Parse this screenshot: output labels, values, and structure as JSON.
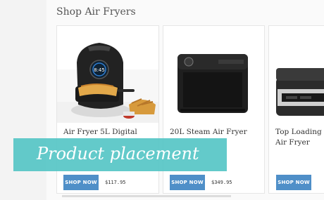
{
  "section": {
    "title": "Shop Air Fryers"
  },
  "products": [
    {
      "title": "Air Fryer 5L Digital",
      "button": "SHOP NOW",
      "price": "$117.95"
    },
    {
      "title": "20L Steam Air Fryer",
      "button": "SHOP NOW",
      "price": "$349.95"
    },
    {
      "title": "Top Loading Air Fryer",
      "button": "SHOP NOW",
      "price": ""
    }
  ],
  "overlay": {
    "text": "Product placement"
  },
  "colors": {
    "accent_button": "#4f8fc8",
    "overlay": "#52c4c4"
  }
}
